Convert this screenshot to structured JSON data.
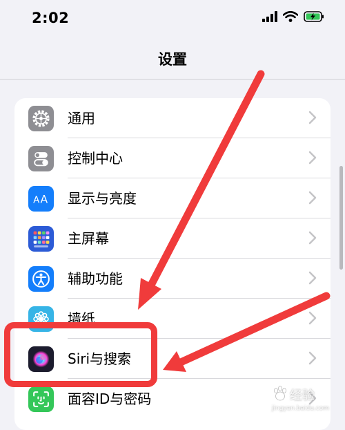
{
  "status_bar": {
    "time": "2:02",
    "icons": [
      "signal-icon",
      "wifi-icon",
      "battery-charging-icon"
    ],
    "battery_color": "#34c759"
  },
  "nav": {
    "title": "设置"
  },
  "settings_items": [
    {
      "label": "通用",
      "icon": "gear-icon",
      "icon_color": "#8e8e93"
    },
    {
      "label": "控制中心",
      "icon": "toggles-icon",
      "icon_color": "#8e8e93"
    },
    {
      "label": "显示与亮度",
      "icon": "text-size-icon",
      "icon_color": "#147efb"
    },
    {
      "label": "主屏幕",
      "icon": "home-grid-icon",
      "icon_color": "#2c5bd6"
    },
    {
      "label": "辅助功能",
      "icon": "accessibility-icon",
      "icon_color": "#147efb"
    },
    {
      "label": "墙纸",
      "icon": "flower-icon",
      "icon_color": "#36b4e6"
    },
    {
      "label": "Siri与搜索",
      "icon": "siri-icon",
      "icon_color": "#1c1c2e"
    },
    {
      "label": "面容ID与密码",
      "icon": "face-id-icon",
      "icon_color": "#34c759"
    }
  ],
  "annotation": {
    "highlight_color": "#f03b3b",
    "highlight_target": "Siri与搜索",
    "arrows": 2
  },
  "watermark": {
    "text": "经验",
    "url": "jingyan.baidu.com"
  }
}
